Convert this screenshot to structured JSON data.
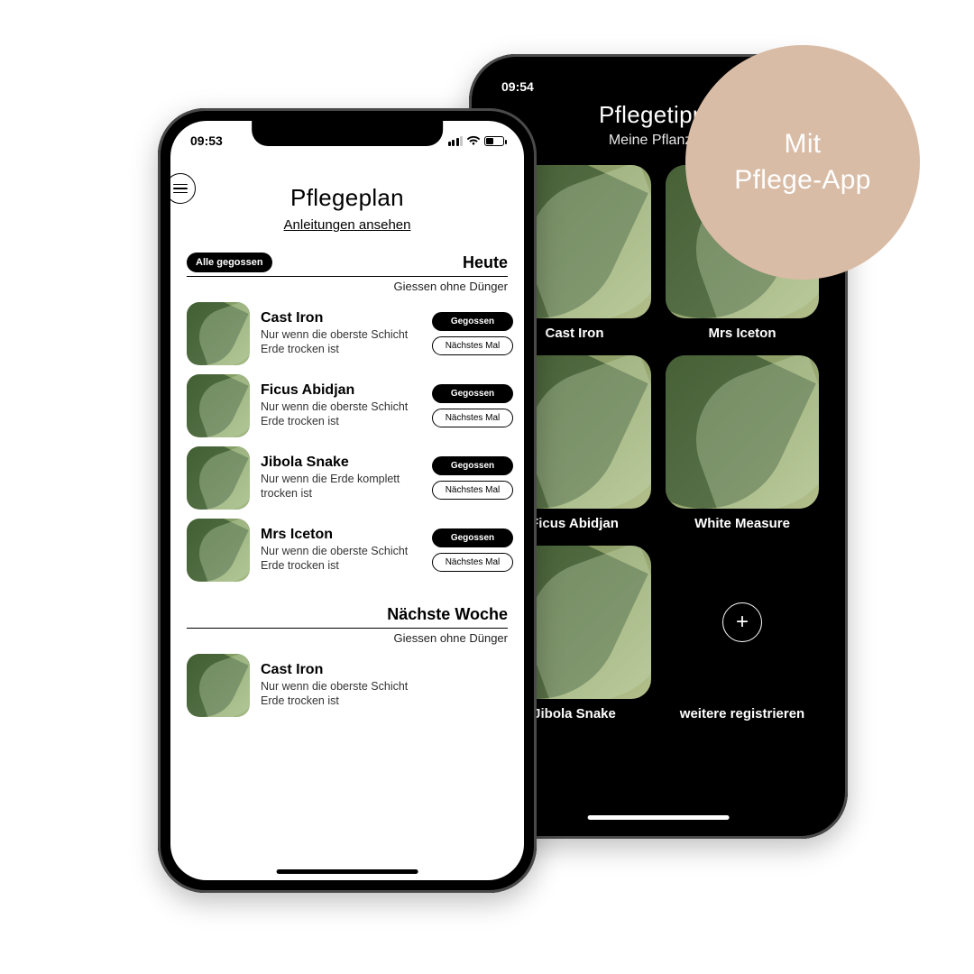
{
  "badge": {
    "text": "Mit\nPflege-App",
    "color": "#d9bca6"
  },
  "phone1": {
    "status_time": "09:53",
    "title": "Pflegeplan",
    "link_text": "Anleitungen ansehen",
    "sections": [
      {
        "header_pill": "Alle gegossen",
        "header_title": "Heute",
        "header_sub": "Giessen ohne Dünger",
        "plants": [
          {
            "name": "Cast Iron",
            "desc": "Nur wenn die oberste Schicht Erde trocken ist",
            "btn1": "Gegossen",
            "btn2": "Nächstes Mal"
          },
          {
            "name": "Ficus Abidjan",
            "desc": "Nur wenn die oberste Schicht Erde trocken ist",
            "btn1": "Gegossen",
            "btn2": "Nächstes Mal"
          },
          {
            "name": "Jibola Snake",
            "desc": "Nur wenn die Erde komplett trocken ist",
            "btn1": "Gegossen",
            "btn2": "Nächstes Mal"
          },
          {
            "name": "Mrs Iceton",
            "desc": "Nur wenn die oberste Schicht Erde trocken ist",
            "btn1": "Gegossen",
            "btn2": "Nächstes Mal"
          }
        ]
      },
      {
        "header_pill": "",
        "header_title": "Nächste Woche",
        "header_sub": "Giessen ohne Dünger",
        "plants": [
          {
            "name": "Cast Iron",
            "desc": "Nur wenn die oberste Schicht Erde trocken ist",
            "btn1": "",
            "btn2": ""
          }
        ]
      }
    ]
  },
  "phone2": {
    "status_time": "09:54",
    "title": "Pflegetipps",
    "subtitle": "Meine Pflanzen",
    "tiles": [
      {
        "label": "Cast Iron"
      },
      {
        "label": "Mrs Iceton"
      },
      {
        "label": "Ficus Abidjan"
      },
      {
        "label": "White Measure"
      },
      {
        "label": "Jibola Snake"
      },
      {
        "label": "weitere registrieren",
        "add": true
      }
    ]
  }
}
